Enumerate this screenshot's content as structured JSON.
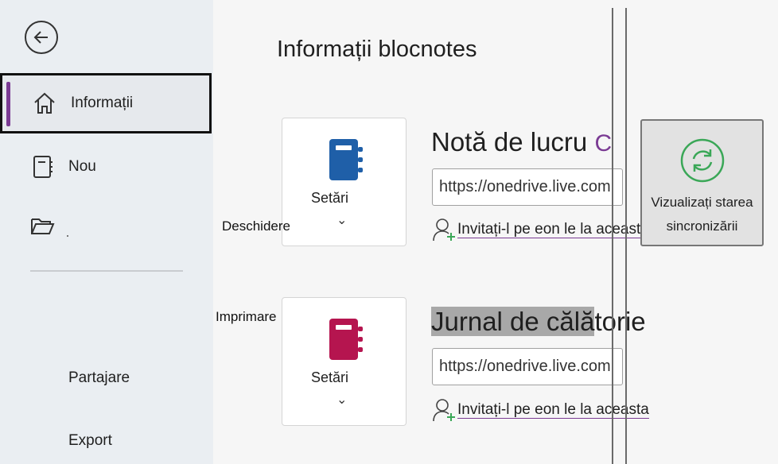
{
  "sidebar": {
    "items": [
      {
        "label": "Informații"
      },
      {
        "label": "Nou"
      },
      {
        "label": ""
      },
      {
        "label": "Partajare"
      },
      {
        "label": "Export"
      }
    ]
  },
  "main": {
    "title": "Informații blocnotes",
    "floating_labels": {
      "open": "Deschidere",
      "print": "Imprimare"
    },
    "notebooks": [
      {
        "name": "Notă de lucru",
        "name_suffix": "C",
        "settings_label": "Setări",
        "url": "https://onedrive.live.com",
        "invite": "Invitați-l pe eon le la aceasta",
        "icon_color": "#1f5fa8"
      },
      {
        "name": "Jurnal de călătorie",
        "name_highlight": "Jurnal de călă",
        "name_rest": "torie",
        "settings_label": "Setări",
        "url": "https://onedrive.live.com",
        "invite": "Invitați-l pe eon le la aceasta",
        "icon_color": "#b5154f"
      }
    ],
    "sync": {
      "label": "Vizualizați starea sincronizării"
    }
  },
  "colors": {
    "accent": "#7a3a93",
    "sync_icon": "#3aa757"
  }
}
